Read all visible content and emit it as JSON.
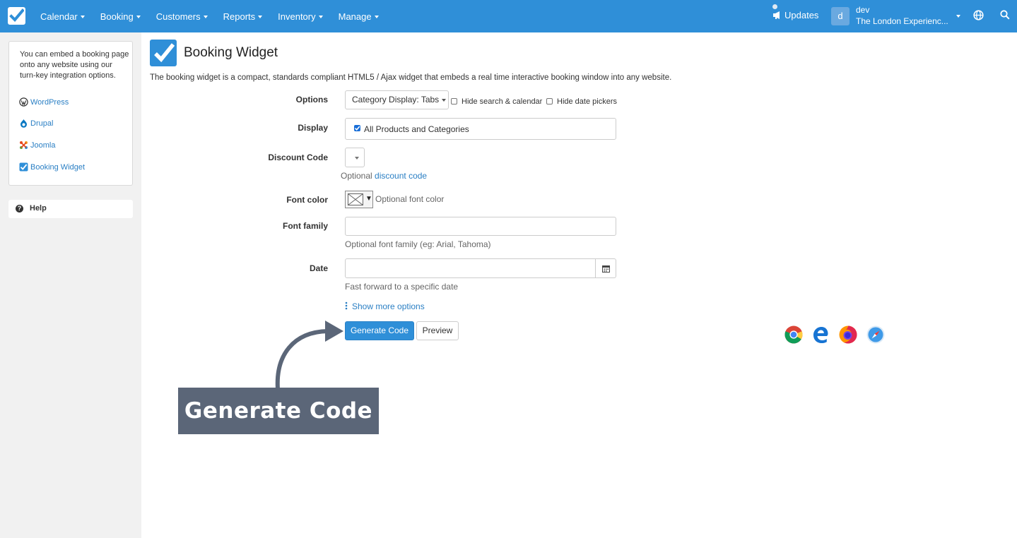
{
  "nav": {
    "items": [
      {
        "label": "Calendar"
      },
      {
        "label": "Booking"
      },
      {
        "label": "Customers"
      },
      {
        "label": "Reports"
      },
      {
        "label": "Inventory"
      },
      {
        "label": "Manage"
      }
    ],
    "updates_label": "Updates",
    "avatar_initial": "d",
    "user_name": "dev",
    "user_org": "The London Experienc...",
    "accent_color": "#2f8fd8"
  },
  "sidebar": {
    "intro": "You can embed a booking page onto any website using our turn-key integration options.",
    "links": [
      {
        "label": "WordPress",
        "icon": "wordpress-icon"
      },
      {
        "label": "Drupal",
        "icon": "drupal-icon"
      },
      {
        "label": "Joomla",
        "icon": "joomla-icon"
      },
      {
        "label": "Booking Widget",
        "icon": "checkbox-icon"
      }
    ],
    "help_label": "Help"
  },
  "page": {
    "title": "Booking Widget",
    "description": "The booking widget is a compact, standards compliant HTML5 / Ajax widget that embeds a real time interactive booking window into any website."
  },
  "form": {
    "options_label": "Options",
    "category_display_value": "Category Display: Tabs",
    "hide_search_label": "Hide search & calendar",
    "hide_date_label": "Hide date pickers",
    "display_label": "Display",
    "display_value": "All Products and Categories",
    "discount_label": "Discount Code",
    "discount_help_prefix": "Optional",
    "discount_help_link": "discount code",
    "font_color_label": "Font color",
    "font_color_help": "Optional font color",
    "font_family_label": "Font family",
    "font_family_value": "",
    "font_family_help": "Optional font family (eg: Arial, Tahoma)",
    "date_label": "Date",
    "date_value": "",
    "date_help": "Fast forward to a specific date",
    "more_options_label": "Show more options",
    "generate_label": "Generate Code",
    "preview_label": "Preview"
  },
  "browsers": [
    "chrome-icon",
    "edge-icon",
    "firefox-icon",
    "safari-icon"
  ],
  "callout": {
    "text": "Generate Code"
  }
}
